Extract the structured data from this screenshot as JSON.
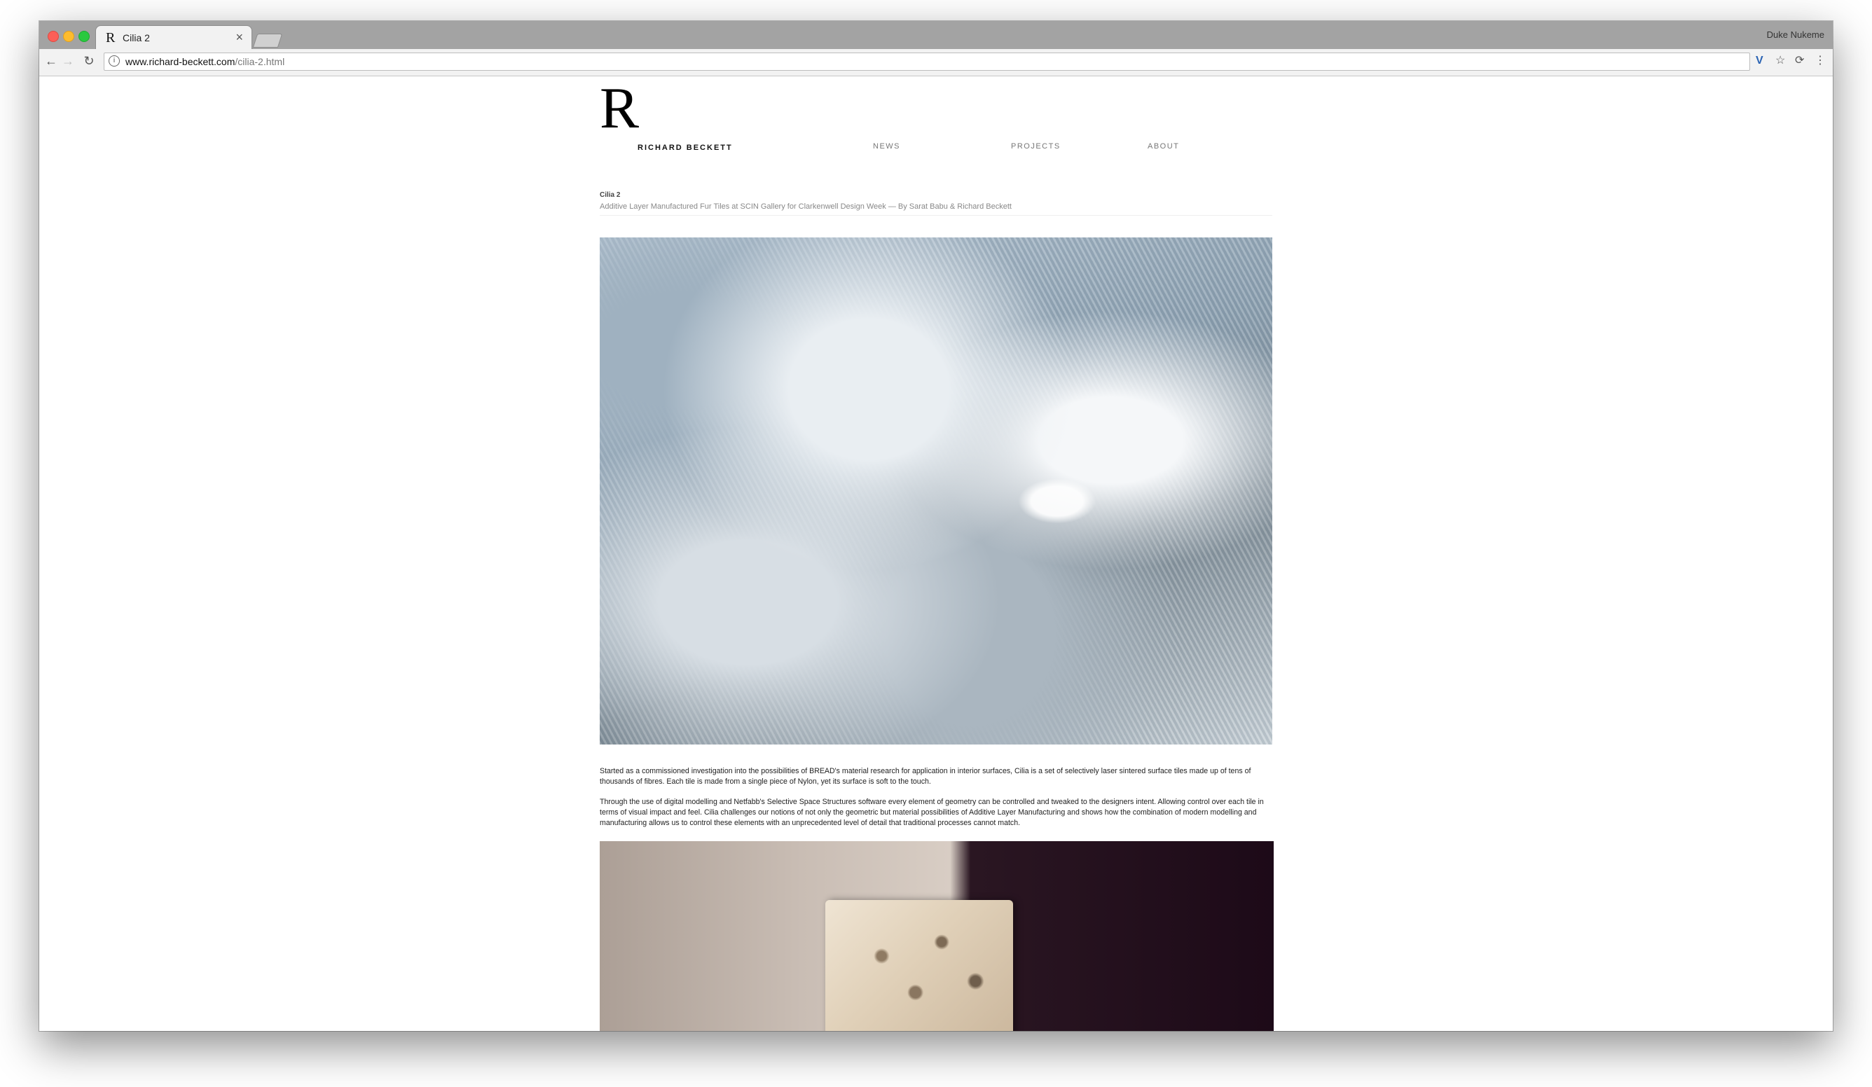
{
  "browser": {
    "tab_title": "Cilia 2",
    "tab_close": "×",
    "profile_name": "Duke Nukeme",
    "url_domain": "www.richard-beckett.com",
    "url_path": "/cilia-2.html",
    "icons": [
      "back-icon",
      "forward-icon",
      "reload-icon",
      "info-icon",
      "extension-icon",
      "star-icon",
      "sync-icon",
      "menu-icon"
    ]
  },
  "site": {
    "logo_mark": "R",
    "logo_name": "RICHARD BECKETT",
    "nav": {
      "news": "NEWS",
      "projects": "PROJECTS",
      "about": "ABOUT"
    }
  },
  "article": {
    "breadcrumb": "Cilia 2",
    "subtitle": "Additive Layer Manufactured Fur Tiles at SCIN Gallery for Clarkenwell Design Week — By Sarat Babu & Richard Beckett",
    "paragraph_1": "Started as a commissioned investigation into the possibilities of BREAD's material research for application in interior surfaces, Cilia is a set of selectively laser sintered surface tiles made up of tens of thousands of fibres. Each tile is made from a single piece of Nylon, yet its surface is soft to the touch.",
    "paragraph_2": "Through the use of digital modelling and Netfabb's Selective Space Structures software every element of geometry can be controlled and tweaked to the designers intent. Allowing control over each tile in terms of visual impact and feel. Cilia challenges our notions of not only the geometric but material possibilities of Additive Layer Manufacturing and shows how the combination of modern modelling and manufacturing allows us to control these elements with an unprecedented level of detail that traditional processes cannot match."
  }
}
